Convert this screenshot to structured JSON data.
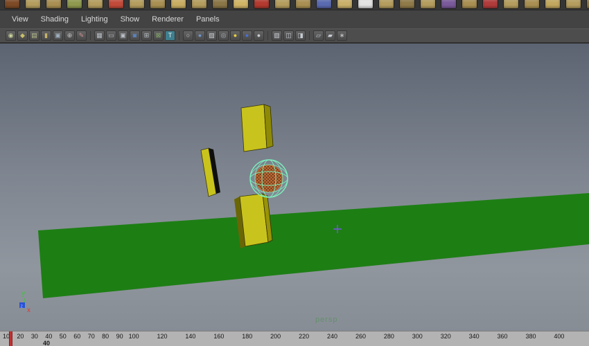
{
  "menu": {
    "items": [
      "View",
      "Shading",
      "Lighting",
      "Show",
      "Renderer",
      "Panels"
    ]
  },
  "shelf": {
    "icons": [
      {
        "c": "#7d4a26"
      },
      {
        "c": "#b49d5e"
      },
      {
        "c": "#a98f52"
      },
      {
        "c": "#8f9a4e"
      },
      {
        "c": "#b49d5e"
      },
      {
        "c": "#c24a3a"
      },
      {
        "c": "#b49d5e"
      },
      {
        "c": "#a98f52"
      },
      {
        "c": "#c9ad62"
      },
      {
        "c": "#b49d5e"
      },
      {
        "c": "#8a7647"
      },
      {
        "c": "#d2b567"
      },
      {
        "c": "#b43a30"
      },
      {
        "c": "#b49d5e"
      },
      {
        "c": "#a98f52"
      },
      {
        "c": "#5a6ab0"
      },
      {
        "c": "#c9b06a"
      },
      {
        "c": "#e3e3e3"
      },
      {
        "c": "#b49d5e"
      },
      {
        "c": "#8f7a49"
      },
      {
        "c": "#b49d5e"
      },
      {
        "c": "#7a5a9a"
      },
      {
        "c": "#a98f52"
      },
      {
        "c": "#b23b3b"
      },
      {
        "c": "#b49d5e"
      },
      {
        "c": "#a98f52"
      },
      {
        "c": "#c2a75f"
      },
      {
        "c": "#b49d5e"
      },
      {
        "c": "#90784a"
      },
      {
        "c": "#b49d5e"
      }
    ]
  },
  "toolbar": {
    "groups": [
      {
        "items": [
          {
            "name": "select-camera-icon",
            "glyph": "◉",
            "color": "#ccd29b"
          },
          {
            "name": "lock-camera-icon",
            "glyph": "◆",
            "color": "#c9c06a"
          },
          {
            "name": "camera-attributes-icon",
            "glyph": "▤",
            "color": "#b9c08c"
          },
          {
            "name": "bookmark-icon",
            "glyph": "▮",
            "color": "#c7b469"
          },
          {
            "name": "image-plane-icon",
            "glyph": "▣",
            "color": "#9fb0bf"
          },
          {
            "name": "pan-zoom-icon",
            "glyph": "⊕",
            "color": "#c3c3c3"
          },
          {
            "name": "grease-pencil-icon",
            "glyph": "✎",
            "color": "#d09090"
          }
        ]
      },
      {
        "items": [
          {
            "name": "grid-icon",
            "glyph": "▦",
            "color": "#b9bfc6"
          },
          {
            "name": "film-gate-icon",
            "glyph": "▭",
            "color": "#b9bfc6"
          },
          {
            "name": "resolution-gate-icon",
            "glyph": "▣",
            "color": "#b9bfc6"
          },
          {
            "name": "gate-mask-icon",
            "glyph": "◙",
            "color": "#5b87c5"
          },
          {
            "name": "field-chart-icon",
            "glyph": "⊞",
            "color": "#b9bfc6"
          },
          {
            "name": "safe-action-icon",
            "glyph": "⊠",
            "color": "#86b06a"
          },
          {
            "name": "safe-title-icon",
            "glyph": "T",
            "color": "#eaf2f2",
            "bg": "#3f7f8f"
          }
        ]
      },
      {
        "items": [
          {
            "name": "wireframe-icon",
            "glyph": "○",
            "color": "#cdd3da"
          },
          {
            "name": "smooth-shade-icon",
            "glyph": "●",
            "color": "#6f93c9"
          },
          {
            "name": "textured-icon",
            "glyph": "▨",
            "color": "#cdd3da"
          },
          {
            "name": "default-material-icon",
            "glyph": "◎",
            "color": "#aab2ba"
          },
          {
            "name": "use-all-lights-icon",
            "glyph": "●",
            "color": "#e8cf3e"
          },
          {
            "name": "shadows-icon",
            "glyph": "●",
            "color": "#4a6fd4"
          },
          {
            "name": "ambient-occlusion-icon",
            "glyph": "●",
            "color": "#c7ccd2"
          }
        ]
      },
      {
        "items": [
          {
            "name": "isolate-select-icon",
            "glyph": "▧",
            "color": "#c7ccd2"
          },
          {
            "name": "xray-icon",
            "glyph": "◫",
            "color": "#c7ccd2"
          },
          {
            "name": "xray-joints-icon",
            "glyph": "◨",
            "color": "#c7ccd2"
          }
        ]
      },
      {
        "items": [
          {
            "name": "snapshot-a-icon",
            "glyph": "▱",
            "color": "#c7ccd2"
          },
          {
            "name": "snapshot-b-icon",
            "glyph": "▰",
            "color": "#c7ccd2"
          },
          {
            "name": "share-icon",
            "glyph": "∗",
            "color": "#c7ccd2"
          }
        ]
      }
    ]
  },
  "viewport": {
    "camera_label": "persp",
    "axis_labels": {
      "x": "x",
      "y": "y",
      "z": "z"
    },
    "colors": {
      "bg_top": "#5c6472",
      "bg_bottom": "#90969e",
      "ground": "#1d7e14",
      "box_face": "#c9c31d",
      "box_side": "#999307",
      "box_dark": "#0e0e0c",
      "selection_wire": "#7df2be",
      "sphere_wire": "#d07838",
      "locator": "#7a52e8",
      "camera_label_color": "#63906b",
      "axis_x": "#e03636",
      "axis_y": "#3cc43c",
      "axis_z": "#2a52d8"
    }
  },
  "timeline": {
    "ticks": [
      10,
      20,
      30,
      40,
      50,
      60,
      70,
      80,
      90,
      100,
      120,
      140,
      160,
      180,
      200,
      220,
      240,
      260,
      280,
      300,
      320,
      340,
      360,
      380,
      400
    ],
    "current_frame": 13,
    "range_label": "40"
  }
}
